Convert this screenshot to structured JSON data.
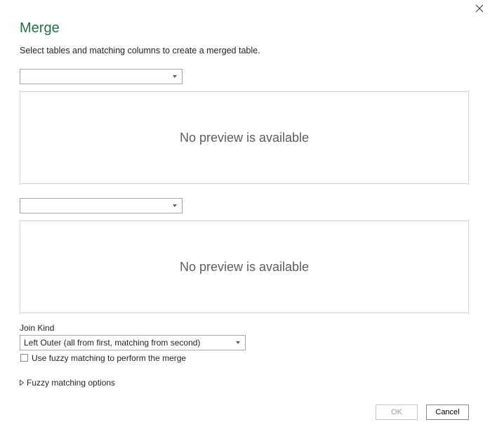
{
  "dialog": {
    "title": "Merge",
    "subtitle": "Select tables and matching columns to create a merged table."
  },
  "first_table": {
    "selected": "",
    "preview_message": "No preview is available"
  },
  "second_table": {
    "selected": "",
    "preview_message": "No preview is available"
  },
  "join": {
    "label": "Join Kind",
    "selected": "Left Outer (all from first, matching from second)"
  },
  "fuzzy": {
    "checkbox_label": "Use fuzzy matching to perform the merge",
    "checked": false,
    "options_label": "Fuzzy matching options"
  },
  "buttons": {
    "ok_label": "OK",
    "cancel_label": "Cancel"
  },
  "colors": {
    "title": "#217346",
    "border": "#a6a6a6",
    "preview_text": "#605e5c"
  },
  "icons": {
    "close": "close-icon",
    "dropdown": "chevron-down-icon",
    "expander": "triangle-right-icon"
  }
}
